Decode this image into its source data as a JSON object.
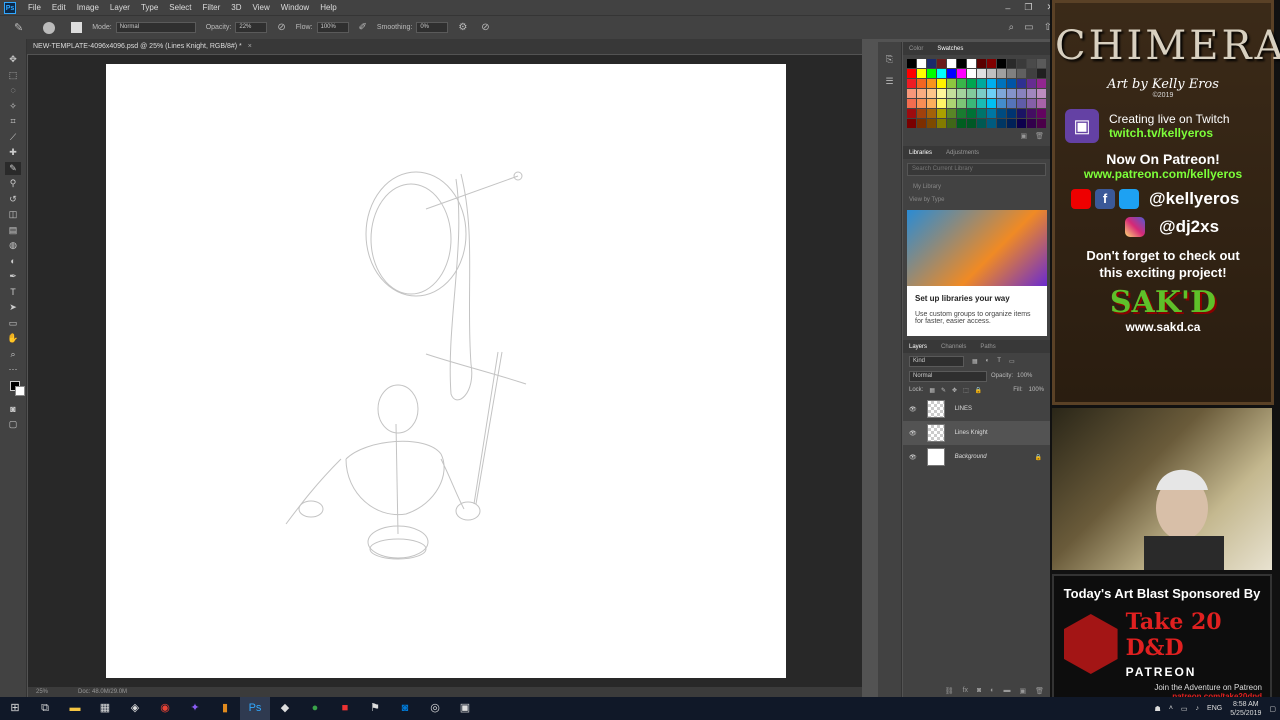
{
  "menubar": {
    "logo": "Ps",
    "items": [
      "File",
      "Edit",
      "Image",
      "Layer",
      "Type",
      "Select",
      "Filter",
      "3D",
      "View",
      "Window",
      "Help"
    ]
  },
  "options": {
    "mode_label": "Mode:",
    "mode_value": "Normal",
    "opacity_label": "Opacity:",
    "opacity_value": "22%",
    "flow_label": "Flow:",
    "flow_value": "100%",
    "smoothing_label": "Smoothing:",
    "smoothing_value": "0%"
  },
  "document": {
    "tab_title": "NEW-TEMPLATE-4096x4096.psd @ 25% (Lines Knight, RGB/8#) *",
    "close": "×",
    "zoom": "25%",
    "doc_size": "Doc: 48.0M/29.0M"
  },
  "panels": {
    "color_tab": "Color",
    "swatches_tab": "Swatches",
    "libraries_tab": "Libraries",
    "adjustments_tab": "Adjustments",
    "search_placeholder": "Search Current Library",
    "my_library": "My Library",
    "view_by_type": "View by Type",
    "lib_card_title": "Set up libraries your way",
    "lib_card_text": "Use custom groups to organize items for faster, easier access.",
    "layers_tab": "Layers",
    "channels_tab": "Channels",
    "paths_tab": "Paths",
    "kind": "Kind",
    "blend_mode": "Normal",
    "opacity_label": "Opacity:",
    "opacity_value": "100%",
    "lock_label": "Lock:",
    "fill_label": "Fill:",
    "fill_value": "100%",
    "layers": [
      {
        "name": "LINES"
      },
      {
        "name": "Lines Knight"
      },
      {
        "name": "Background"
      }
    ]
  },
  "swatch_colors": [
    "#000000",
    "#ffffff",
    "#1c2a6b",
    "#6b1c1c",
    "#ffffff",
    "#000000",
    "#ffffff",
    "#5a0000",
    "#800000",
    "#000000",
    "#2a2a2a",
    "#3a3a3a",
    "#4a4a4a",
    "#5a5a5a",
    "#ff0000",
    "#ffff00",
    "#00ff00",
    "#00ffff",
    "#0000ff",
    "#ff00ff",
    "#ffffff",
    "#e0e0e0",
    "#c0c0c0",
    "#a0a0a0",
    "#808080",
    "#606060",
    "#404040",
    "#202020",
    "#ed1c24",
    "#f26522",
    "#f7941d",
    "#fff200",
    "#8dc63f",
    "#39b54a",
    "#00a651",
    "#00a99d",
    "#00aeef",
    "#0072bc",
    "#0054a6",
    "#2e3192",
    "#662d91",
    "#92278f",
    "#f7977a",
    "#f9ad81",
    "#fdc68a",
    "#fff79a",
    "#c4df9b",
    "#a3d39c",
    "#82ca9c",
    "#7accc8",
    "#6dcff6",
    "#7ea7d8",
    "#8493ca",
    "#8882be",
    "#a187be",
    "#bc8cbf",
    "#f26c4f",
    "#f68e55",
    "#fbaf5c",
    "#fff467",
    "#acd372",
    "#7cc576",
    "#3bb878",
    "#1abbb4",
    "#00bff3",
    "#438ccb",
    "#5574b9",
    "#605ca8",
    "#855fa8",
    "#a763a8",
    "#9e0b0f",
    "#a0410d",
    "#a36209",
    "#aba000",
    "#598527",
    "#1a7b30",
    "#007236",
    "#00746b",
    "#0076a3",
    "#004b80",
    "#003471",
    "#1b1464",
    "#440e62",
    "#630460",
    "#790000",
    "#7b2e00",
    "#7d4900",
    "#827b00",
    "#406618",
    "#005e20",
    "#005826",
    "#005952",
    "#005b7f",
    "#003663",
    "#002157",
    "#0d004c",
    "#32004b",
    "#4b0049"
  ],
  "overlay": {
    "title": "CHIMERA",
    "byline": "Art by Kelly Eros",
    "year": "©2019",
    "twitch_line1": "Creating live on Twitch",
    "twitch_line2": "twitch.tv/kellyeros",
    "patreon_line1": "Now On Patreon!",
    "patreon_line2": "www.patreon.com/kellyeros",
    "social1": "@kellyeros",
    "social2": "@dj2xs",
    "check_out": "Don't forget to check out this exciting project!",
    "sakd_logo": "SAK'D",
    "sakd_url": "www.sakd.ca",
    "sponsor_heading": "Today's Art Blast Sponsored By",
    "sponsor_brand": "Take 20 D&D",
    "sponsor_platform": "PATREON",
    "sponsor_text": "Join the Adventure on Patreon",
    "sponsor_url": "patreon.com/take20dnd"
  },
  "taskbar": {
    "clock_time": "8:58 AM",
    "clock_date": "5/25/2019",
    "lang": "ENG"
  }
}
